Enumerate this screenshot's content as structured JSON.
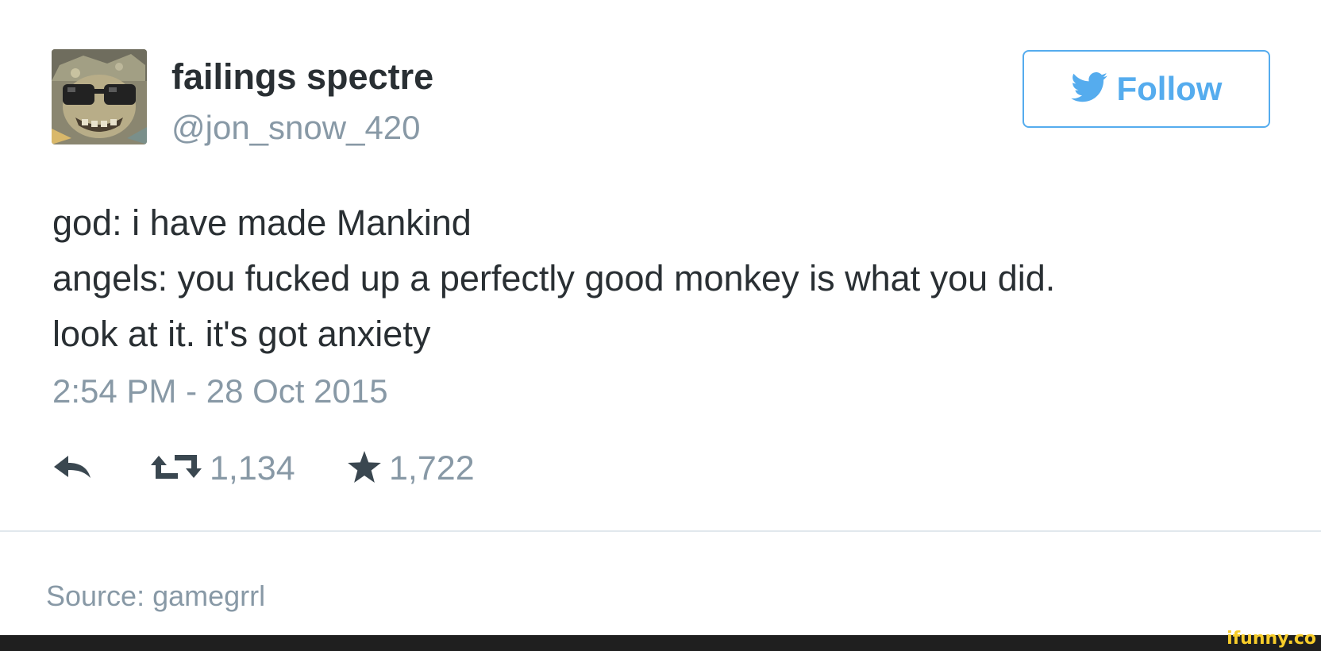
{
  "tweet": {
    "display_name": "failings spectre",
    "handle": "@jon_snow_420",
    "follow_label": "Follow",
    "text_lines": [
      "god: i have made Mankind",
      "angels: you fucked up a perfectly good monkey is what you did.",
      "look at it. it's got anxiety"
    ],
    "timestamp": "2:54 PM - 28 Oct 2015",
    "actions": {
      "reply_icon": "reply-icon",
      "retweet_icon": "retweet-icon",
      "retweet_count": "1,134",
      "favorite_icon": "star-icon",
      "favorite_count": "1,722"
    }
  },
  "source": "Source: gamegrrl",
  "watermark": "ifunny.co",
  "colors": {
    "brand_blue": "#55acee",
    "text_dark": "#292f33",
    "text_muted": "#8899a6",
    "icon_dark": "#3a4750",
    "watermark": "#f7cd2a",
    "footer_bar": "#1f1f1f"
  }
}
